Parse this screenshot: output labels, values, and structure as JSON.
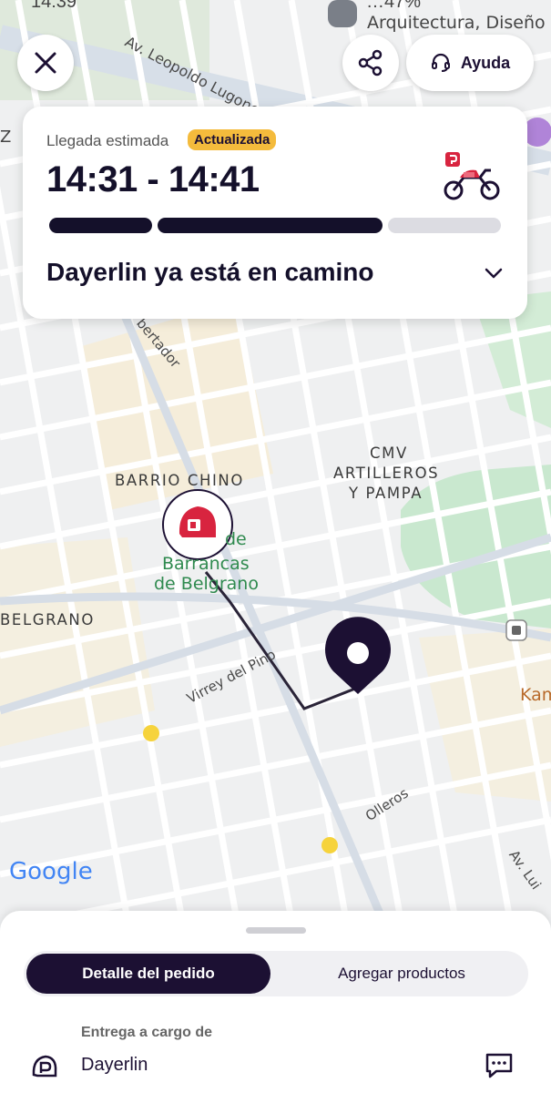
{
  "status_bar": {
    "time": "14:39",
    "right_text": "…47%"
  },
  "top_actions": {
    "help_label": "Ayuda"
  },
  "eta_card": {
    "label": "Llegada estimada",
    "badge": "Actualizada",
    "time_range": "14:31 - 14:41",
    "status_text": "Dayerlin ya está en camino",
    "progress_segments": [
      {
        "state": "done",
        "fraction": 0.24
      },
      {
        "state": "done",
        "fraction": 0.51
      },
      {
        "state": "pending",
        "fraction": 0.25
      }
    ]
  },
  "map": {
    "labels": {
      "barrio_chino": "BARRIO CHINO",
      "cmv_line1": "CMV",
      "cmv_line2": "ARTILLEROS",
      "cmv_line3": "Y PAMPA",
      "belgrano": "BELGRANO",
      "barrancas_line1": "Barrancas",
      "barrancas_line2": "de Belgrano",
      "barrancas_prefix": "de",
      "virrey_del_pino": "Virrey del Pino",
      "olleros": "Olleros",
      "leopoldo_lugones": "Av. Leopoldo Lugones",
      "libertador": "bertador",
      "av_luis": "Av. Lui",
      "kam": "Kam",
      "arquitectura": "Arquitectura, Diseño",
      "z_edge": "Z",
      "google": "Google"
    },
    "colors": {
      "route": "#2a2438",
      "pin": "#1c1033",
      "courier": "#d8243f"
    }
  },
  "bottom_sheet": {
    "tabs": [
      {
        "label": "Detalle del pedido",
        "active": true
      },
      {
        "label": "Agregar productos",
        "active": false
      }
    ],
    "delivery_caption": "Entrega a cargo de",
    "courier_name": "Dayerlin"
  },
  "colors": {
    "brand_dark": "#1c1033",
    "badge": "#f4bb3c",
    "courier_red": "#d8243f"
  }
}
